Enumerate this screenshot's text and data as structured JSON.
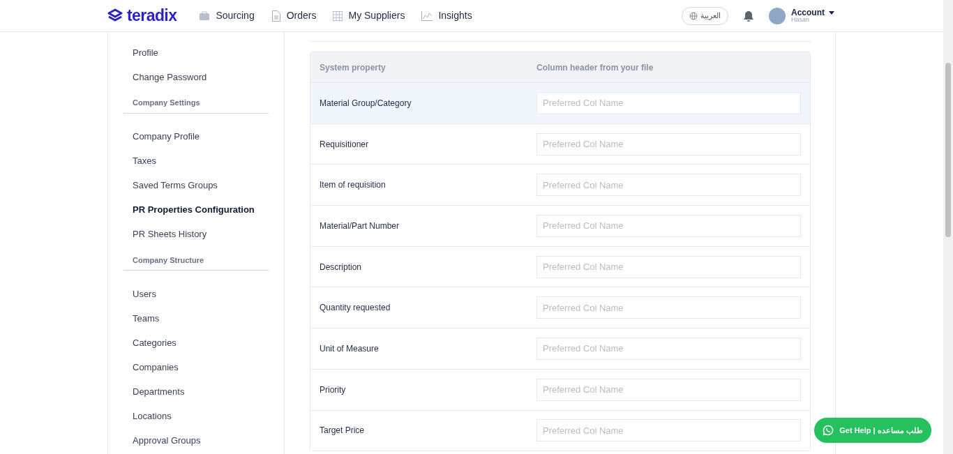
{
  "header": {
    "logo": "teradix",
    "nav": [
      {
        "kind": "briefcase",
        "label": "Sourcing"
      },
      {
        "kind": "document",
        "label": "Orders"
      },
      {
        "kind": "grid",
        "label": "My Suppliers"
      },
      {
        "kind": "chart",
        "label": "Insights"
      }
    ],
    "language_button": "العربية",
    "account": {
      "label": "Account",
      "user": "Hasan"
    }
  },
  "sidebar": [
    {
      "kind": "item",
      "label": "Profile",
      "selected": false
    },
    {
      "kind": "item",
      "label": "Change Password",
      "selected": false
    },
    {
      "kind": "section",
      "label": "Company Settings"
    },
    {
      "kind": "item",
      "label": "Company Profile",
      "selected": false
    },
    {
      "kind": "item",
      "label": "Taxes",
      "selected": false
    },
    {
      "kind": "item",
      "label": "Saved Terms Groups",
      "selected": false
    },
    {
      "kind": "item",
      "label": "PR Properties Configuration",
      "selected": true
    },
    {
      "kind": "item",
      "label": "PR Sheets History",
      "selected": false
    },
    {
      "kind": "section",
      "label": "Company Structure"
    },
    {
      "kind": "item",
      "label": "Users",
      "selected": false
    },
    {
      "kind": "item",
      "label": "Teams",
      "selected": false
    },
    {
      "kind": "item",
      "label": "Categories",
      "selected": false
    },
    {
      "kind": "item",
      "label": "Companies",
      "selected": false
    },
    {
      "kind": "item",
      "label": "Departments",
      "selected": false
    },
    {
      "kind": "item",
      "label": "Locations",
      "selected": false
    },
    {
      "kind": "item",
      "label": "Approval Groups",
      "selected": false
    }
  ],
  "table": {
    "columns": [
      "System property",
      "Column header from your file"
    ],
    "rows": [
      {
        "property": "Material Group/Category",
        "placeholder": "Preferred Col Name",
        "selected": true
      },
      {
        "property": "Requisitioner",
        "placeholder": "Preferred Col Name",
        "selected": false
      },
      {
        "property": "Item of requisition",
        "placeholder": "Preferred Col Name",
        "selected": false
      },
      {
        "property": "Material/Part Number",
        "placeholder": "Preferred Col Name",
        "selected": false
      },
      {
        "property": "Description",
        "placeholder": "Preferred Col Name",
        "selected": false
      },
      {
        "property": "Quantity requested",
        "placeholder": "Preferred Col Name",
        "selected": false
      },
      {
        "property": "Unit of Measure",
        "placeholder": "Preferred Col Name",
        "selected": false
      },
      {
        "property": "Priority",
        "placeholder": "Preferred Col Name",
        "selected": false
      },
      {
        "property": "Target Price",
        "placeholder": "Preferred Col Name",
        "selected": false
      }
    ]
  },
  "help_button": "Get Help | طلب مساعده"
}
